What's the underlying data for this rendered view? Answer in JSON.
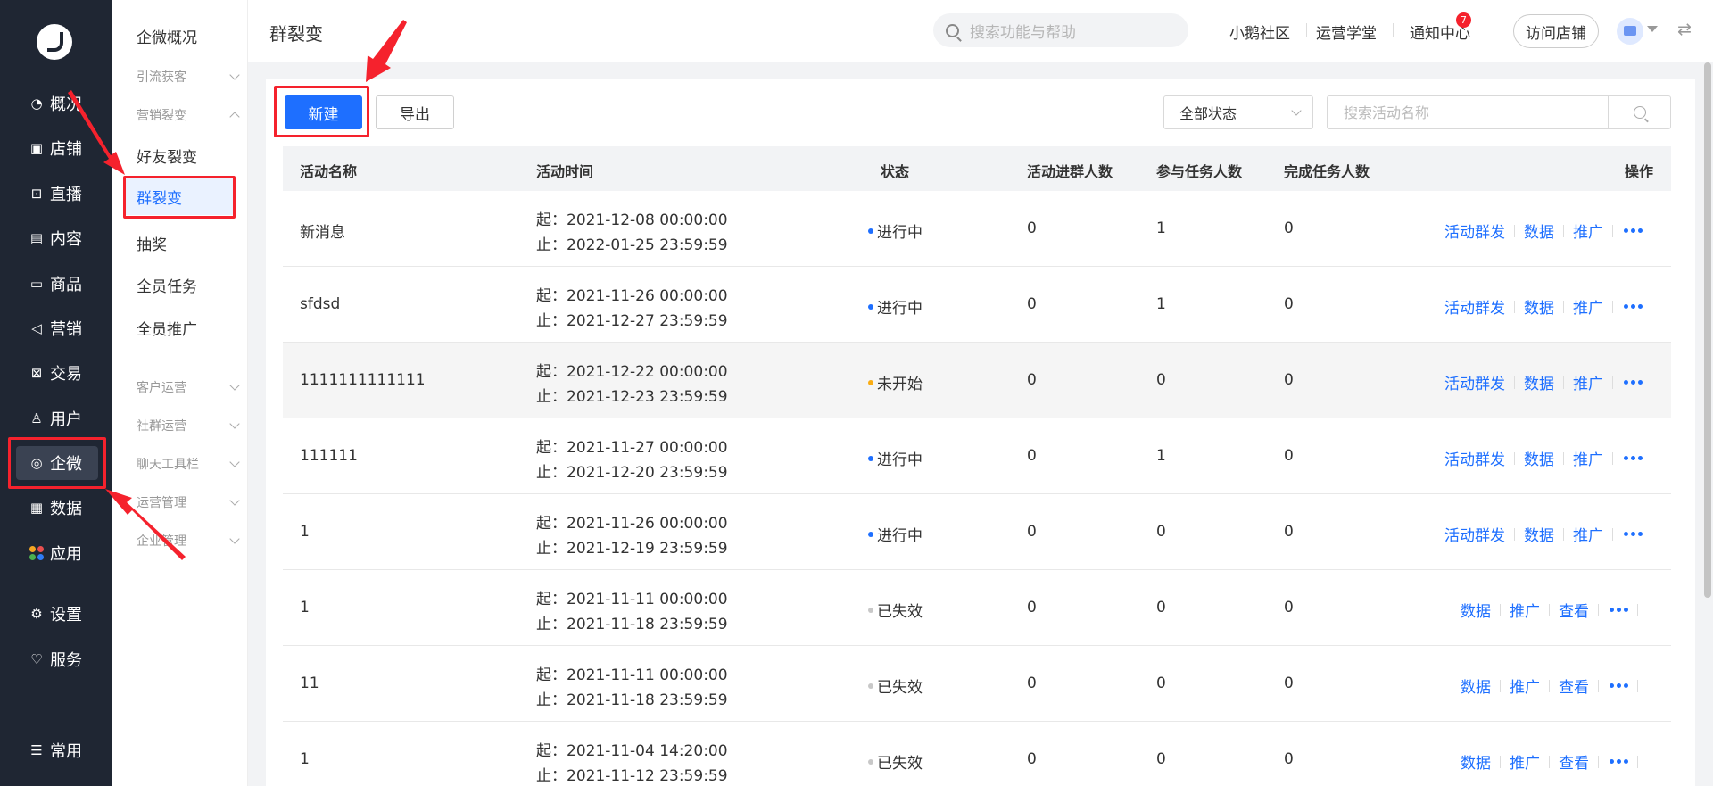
{
  "rail": {
    "items": [
      {
        "label": "概况",
        "icon": "dashboard-icon"
      },
      {
        "label": "店铺",
        "icon": "shop-icon"
      },
      {
        "label": "直播",
        "icon": "live-icon"
      },
      {
        "label": "内容",
        "icon": "content-icon"
      },
      {
        "label": "商品",
        "icon": "goods-icon"
      },
      {
        "label": "营销",
        "icon": "megaphone-icon"
      },
      {
        "label": "交易",
        "icon": "trade-icon"
      },
      {
        "label": "用户",
        "icon": "user-icon"
      },
      {
        "label": "企微",
        "icon": "wecom-icon"
      },
      {
        "label": "数据",
        "icon": "chart-icon"
      },
      {
        "label": "应用",
        "icon": "apps-icon"
      },
      {
        "label": "设置",
        "icon": "gear-icon"
      },
      {
        "label": "服务",
        "icon": "service-icon"
      },
      {
        "label": "常用",
        "icon": "list-icon"
      }
    ],
    "active": "企微"
  },
  "submenu": {
    "overview": "企微概况",
    "groups": [
      "引流获客",
      "营销裂变",
      "客户运营",
      "社群运营",
      "聊天工具栏",
      "运营管理",
      "企业管理"
    ],
    "items": [
      "好友裂变",
      "群裂变",
      "抽奖",
      "全员任务",
      "全员推广"
    ],
    "active": "群裂变"
  },
  "topbar": {
    "title": "群裂变",
    "search_placeholder": "搜索功能与帮助",
    "links": [
      "小鹅社区",
      "运营学堂",
      "通知中心"
    ],
    "notify_count": "7",
    "visit_store": "访问店铺"
  },
  "toolbar": {
    "new_label": "新建",
    "export_label": "导出",
    "status_filter": "全部状态",
    "search_placeholder": "搜索活动名称"
  },
  "table": {
    "columns": [
      "活动名称",
      "活动时间",
      "状态",
      "活动进群人数",
      "参与任务人数",
      "完成任务人数",
      "操作"
    ],
    "rows": [
      {
        "name": "新消息",
        "start": "起：2021-12-08 00:00:00",
        "end": "止：2022-01-25 23:59:59",
        "status": "进行中",
        "status_color": "#1e6fff",
        "joined": "0",
        "participants": "1",
        "completed": "0",
        "ops": [
          "活动群发",
          "数据",
          "推广"
        ]
      },
      {
        "name": "sfdsd",
        "start": "起：2021-11-26 00:00:00",
        "end": "止：2021-12-27 23:59:59",
        "status": "进行中",
        "status_color": "#1e6fff",
        "joined": "0",
        "participants": "1",
        "completed": "0",
        "ops": [
          "活动群发",
          "数据",
          "推广"
        ]
      },
      {
        "name": "1111111111111",
        "start": "起：2021-12-22 00:00:00",
        "end": "止：2021-12-23 23:59:59",
        "status": "未开始",
        "status_color": "#faad14",
        "joined": "0",
        "participants": "0",
        "completed": "0",
        "ops": [
          "活动群发",
          "数据",
          "推广"
        ]
      },
      {
        "name": "111111",
        "start": "起：2021-11-27 00:00:00",
        "end": "止：2021-12-20 23:59:59",
        "status": "进行中",
        "status_color": "#1e6fff",
        "joined": "0",
        "participants": "1",
        "completed": "0",
        "ops": [
          "活动群发",
          "数据",
          "推广"
        ]
      },
      {
        "name": "1",
        "start": "起：2021-11-26 00:00:00",
        "end": "止：2021-12-19 23:59:59",
        "status": "进行中",
        "status_color": "#1e6fff",
        "joined": "0",
        "participants": "0",
        "completed": "0",
        "ops": [
          "活动群发",
          "数据",
          "推广"
        ]
      },
      {
        "name": "1",
        "start": "起：2021-11-11 00:00:00",
        "end": "止：2021-11-18 23:59:59",
        "status": "已失效",
        "status_color": "#c8c8c8",
        "joined": "0",
        "participants": "0",
        "completed": "0",
        "ops": [
          "数据",
          "推广",
          "查看"
        ]
      },
      {
        "name": "11",
        "start": "起：2021-11-11 00:00:00",
        "end": "止：2021-11-18 23:59:59",
        "status": "已失效",
        "status_color": "#c8c8c8",
        "joined": "0",
        "participants": "0",
        "completed": "0",
        "ops": [
          "数据",
          "推广",
          "查看"
        ]
      },
      {
        "name": "1",
        "start": "起：2021-11-04 14:20:00",
        "end": "止：2021-11-12 23:59:59",
        "status": "已失效",
        "status_color": "#c8c8c8",
        "joined": "0",
        "participants": "0",
        "completed": "0",
        "ops": [
          "数据",
          "推广",
          "查看"
        ]
      }
    ]
  },
  "colors": {
    "accent": "#1e6fff",
    "annotation": "#f5222d",
    "rail_bg": "#1f2633"
  }
}
